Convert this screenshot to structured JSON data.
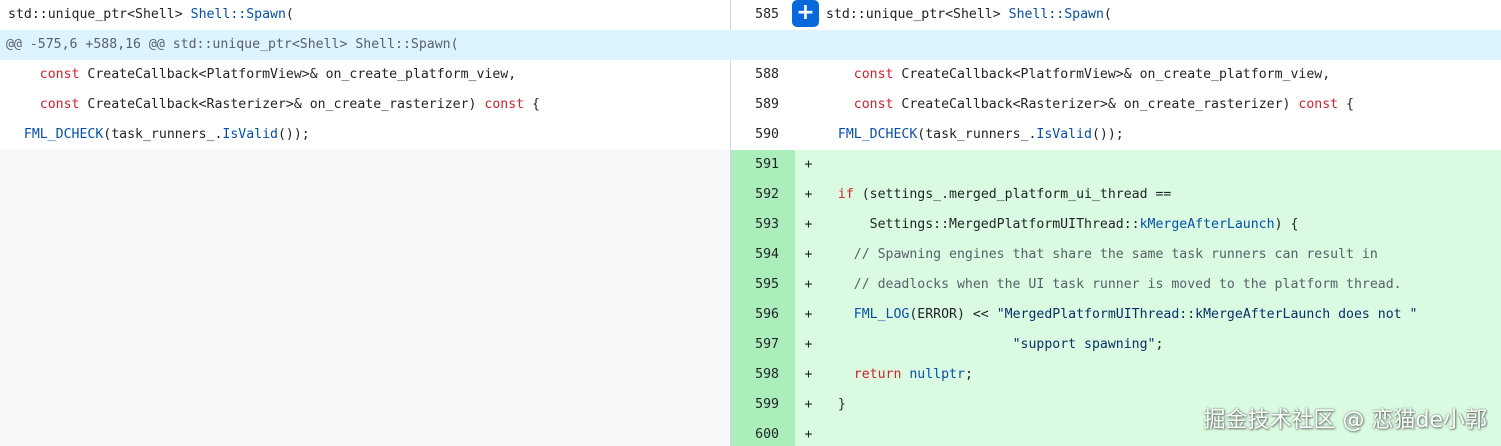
{
  "header": {
    "left_code": [
      "std::unique_ptr<Shell> ",
      "Shell::Spawn",
      "("
    ],
    "right_num": "585",
    "right_code": [
      "std::unique_ptr<Shell> ",
      "Shell::Spawn",
      "("
    ],
    "expand_icon": "plus-icon"
  },
  "hunk_header": "@@ -575,6 +588,16 @@ std::unique_ptr<Shell> Shell::Spawn(",
  "context_rows": [
    {
      "num": "588",
      "parts": [
        "    ",
        "const",
        " CreateCallback<PlatformView>& on_create_platform_view,"
      ]
    },
    {
      "num": "589",
      "parts": [
        "    ",
        "const",
        " CreateCallback<Rasterizer>& on_create_rasterizer) ",
        "const",
        " {"
      ]
    },
    {
      "num": "590",
      "parts": [
        "  ",
        "FML_DCHECK",
        "(task_runners_.",
        "IsValid",
        "());"
      ]
    }
  ],
  "added_rows": [
    {
      "num": "591",
      "marker": "+",
      "parts": [
        ""
      ]
    },
    {
      "num": "592",
      "marker": "+",
      "parts": [
        "  ",
        "if",
        " (settings_.merged_platform_ui_thread =="
      ]
    },
    {
      "num": "593",
      "marker": "+",
      "parts": [
        "      Settings::MergedPlatformUIThread::",
        "kMergeAfterLaunch",
        ") {"
      ]
    },
    {
      "num": "594",
      "marker": "+",
      "parts": [
        "    ",
        "// Spawning engines that share the same task runners can result in"
      ]
    },
    {
      "num": "595",
      "marker": "+",
      "parts": [
        "    ",
        "// deadlocks when the UI task runner is moved to the platform thread."
      ]
    },
    {
      "num": "596",
      "marker": "+",
      "parts": [
        "    ",
        "FML_LOG",
        "(ERROR) << ",
        "\"MergedPlatformUIThread::kMergeAfterLaunch does not \""
      ]
    },
    {
      "num": "597",
      "marker": "+",
      "parts": [
        "                        ",
        "\"support spawning\"",
        ";"
      ]
    },
    {
      "num": "598",
      "marker": "+",
      "parts": [
        "    ",
        "return",
        " ",
        "nullptr",
        ";"
      ]
    },
    {
      "num": "599",
      "marker": "+",
      "parts": [
        "  }"
      ]
    },
    {
      "num": "600",
      "marker": "+",
      "parts": [
        ""
      ]
    }
  ],
  "watermark": "掘金技术社区 @ 恋猫de小郭",
  "colors": {
    "added_line_bg": "#dafbe1",
    "added_num_bg": "#aceebb",
    "hunk_bg": "#ddf4ff",
    "expand_button": "#0969da",
    "keyword": "#cf222e",
    "function": "#0550ae"
  }
}
